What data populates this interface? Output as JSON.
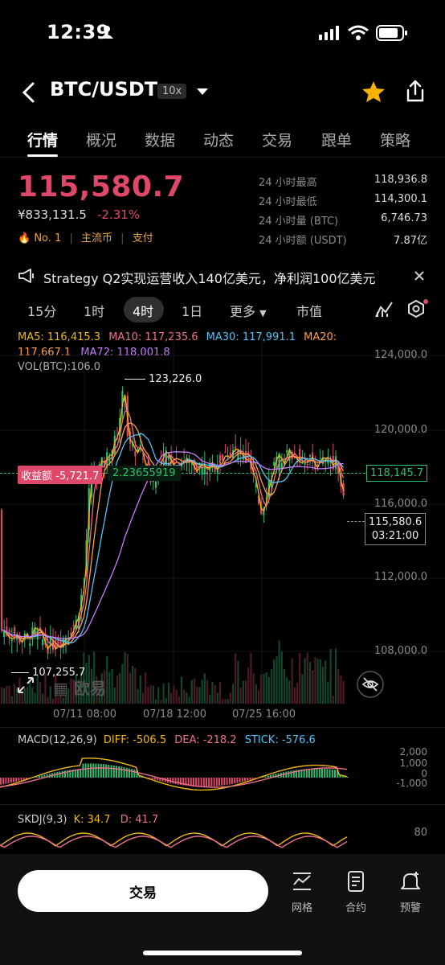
{
  "status_bar": {
    "time": "12:39"
  },
  "header": {
    "pair": "BTC/USDT",
    "leverage": "10x"
  },
  "tabs": [
    "行情",
    "概况",
    "数据",
    "动态",
    "交易",
    "跟单",
    "策略"
  ],
  "ticker": {
    "price": "115,580.7",
    "cny_price": "¥833,131.5",
    "change": "-2.31%",
    "rank": "No. 1",
    "tag1": "主流币",
    "tag2": "支付",
    "stats": [
      {
        "label": "24 小时最高",
        "value": "118,936.8"
      },
      {
        "label": "24 小时最低",
        "value": "114,300.1"
      },
      {
        "label": "24 小时量 (BTC)",
        "value": "6,746.73"
      },
      {
        "label": "24 小时额 (USDT)",
        "value": "7.87亿"
      }
    ]
  },
  "news": {
    "text": "Strategy Q2实现运营收入140亿美元，净利润100亿美元"
  },
  "intervals": {
    "items": [
      "15分",
      "1时",
      "4时",
      "1日",
      "更多",
      "市值"
    ],
    "active": "4时"
  },
  "indicators": {
    "ma5": "MA5: 116,415.3",
    "ma10": "MA10: 117,235.6",
    "ma30": "MA30: 117,991.1",
    "ma20": "MA20:",
    "ma20_val": "117,667.1",
    "ma72": "MA72: 118,001.8",
    "vol": "VOL(BTC):106.0",
    "colors": {
      "ma5": "#f0b90b",
      "ma10": "#f0708a",
      "ma30": "#4fc3f7",
      "ma20": "#ff9f43",
      "ma72": "#c77dff"
    }
  },
  "chart": {
    "high_label": "123,226.0",
    "low_label": "107,255.7",
    "pnl_label": "收益额 -5,721.7",
    "pnl_value": "2.23655919",
    "current_line_label": "118,145.7",
    "last_price_label": "115,580.6",
    "countdown": "03:21:00",
    "y_ticks": [
      "124,000.0",
      "120,000.0",
      "116,000.0",
      "112,000.0",
      "108,000.0"
    ],
    "x_ticks": [
      "07/11 08:00",
      "07/18 12:00",
      "07/25 16:00"
    ],
    "watermark": "欧易"
  },
  "macd": {
    "label": "MACD(12,26,9)",
    "diff": "DIFF: -506.5",
    "dea": "DEA: -218.2",
    "stick": "STICK: -576.6",
    "y_ticks": [
      "2,000",
      "1,000",
      "0",
      "-1,000"
    ]
  },
  "skdj": {
    "label": "SKDJ(9,3)",
    "k": "K: 34.7",
    "d": "D: 41.7",
    "y_tick": "80"
  },
  "bottom": {
    "trade": "交易",
    "items": [
      {
        "label": "网格",
        "icon": "grid-chart-icon"
      },
      {
        "label": "合约",
        "icon": "contract-icon"
      },
      {
        "label": "预警",
        "icon": "alert-bell-icon"
      }
    ]
  }
}
